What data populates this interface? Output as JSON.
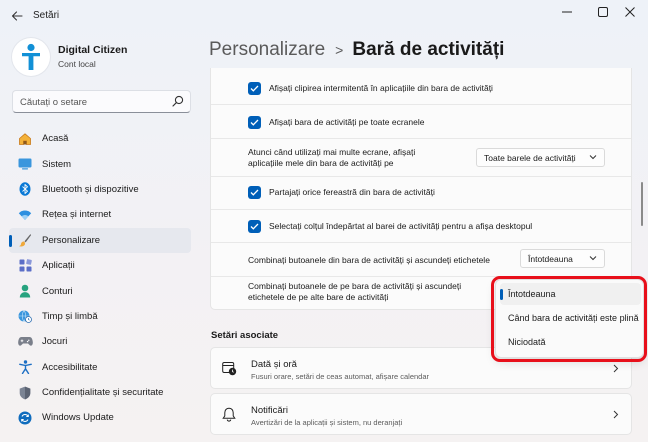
{
  "window": {
    "app_title": "Setări"
  },
  "profile": {
    "name": "Digital Citizen",
    "subtitle": "Cont local"
  },
  "search": {
    "placeholder": "Căutați o setare"
  },
  "sidebar": {
    "items": [
      {
        "label": "Acasă",
        "icon": "home-icon"
      },
      {
        "label": "Sistem",
        "icon": "system-icon"
      },
      {
        "label": "Bluetooth și dispozitive",
        "icon": "bluetooth-icon"
      },
      {
        "label": "Rețea și internet",
        "icon": "wifi-icon"
      },
      {
        "label": "Personalizare",
        "icon": "brush-icon",
        "active": true
      },
      {
        "label": "Aplicații",
        "icon": "apps-icon"
      },
      {
        "label": "Conturi",
        "icon": "account-icon"
      },
      {
        "label": "Timp și limbă",
        "icon": "globe-clock-icon"
      },
      {
        "label": "Jocuri",
        "icon": "gamepad-icon"
      },
      {
        "label": "Accesibilitate",
        "icon": "accessibility-icon"
      },
      {
        "label": "Confidențialitate și securitate",
        "icon": "shield-icon"
      },
      {
        "label": "Windows Update",
        "icon": "update-icon"
      }
    ]
  },
  "header": {
    "parent": "Personalizare",
    "separator": ">",
    "current": "Bară de activități"
  },
  "settings": {
    "flashing_label": "Afișați clipirea intermitentă în aplicațiile din bara de activități",
    "all_displays_label": "Afișați bara de activități pe toate ecranele",
    "multi_display_line1": "Atunci când utilizați mai multe ecrane, afișați",
    "multi_display_line2": "aplicațiile mele din bara de activități pe",
    "multi_display_value": "Toate barele de activități",
    "share_window_label": "Partajați orice fereastră din bara de activități",
    "far_corner_label": "Selectați colțul îndepărtat al barei de activități pentru a afișa desktopul",
    "combine_main_label": "Combinați butoanele din bara de activități și ascundeți etichetele",
    "combine_main_value": "Întotdeauna",
    "combine_other_line1": "Combinați butoanele de pe bara de activități și ascundeți",
    "combine_other_line2": "etichetele de pe alte bare de activități"
  },
  "popup": {
    "options": [
      "Întotdeauna",
      "Când bara de activități este plină",
      "Niciodată"
    ],
    "selected": "Întotdeauna",
    "highlight_color": "#e8101b"
  },
  "related": {
    "title": "Setări asociate",
    "cards": [
      {
        "title": "Dată și oră",
        "subtitle": "Fusuri orare, setări de ceas automat, afișare calendar",
        "icon": "calendar-clock-icon"
      },
      {
        "title": "Notificări",
        "subtitle": "Avertizări de la aplicații și sistem, nu deranjați",
        "icon": "bell-icon"
      }
    ]
  },
  "colors": {
    "accent": "#005fb8"
  }
}
